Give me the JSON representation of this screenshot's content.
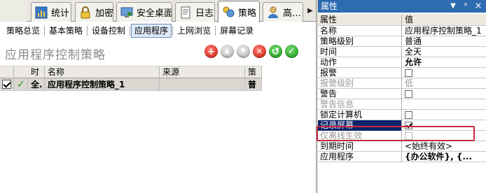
{
  "tabs": [
    {
      "label": "统计",
      "icon": "chart-icon",
      "active": false
    },
    {
      "label": "加密",
      "icon": "lock-icon",
      "active": false
    },
    {
      "label": "安全桌面",
      "icon": "monitor-icon",
      "active": false
    },
    {
      "label": "日志",
      "icon": "log-icon",
      "active": false
    },
    {
      "label": "策略",
      "icon": "policy-icon",
      "active": true
    },
    {
      "label": "高…",
      "icon": "user-icon",
      "active": false
    }
  ],
  "subnav": [
    "策略总览",
    "基本策略",
    "设备控制",
    "应用程序",
    "上网浏览",
    "屏幕记录"
  ],
  "subnav_active": "应用程序",
  "page_title": "应用程序控制策略",
  "actions": [
    {
      "name": "add-icon",
      "glyph": "+",
      "style": "red"
    },
    {
      "name": "move-up-icon",
      "glyph": "▲",
      "style": "gray"
    },
    {
      "name": "move-down-icon",
      "glyph": "▼",
      "style": "gray"
    },
    {
      "name": "delete-icon",
      "glyph": "✕",
      "style": "red"
    },
    {
      "name": "undo-icon",
      "glyph": "↺",
      "style": "green"
    },
    {
      "name": "confirm-icon",
      "glyph": "✓",
      "style": "green"
    }
  ],
  "grid": {
    "columns": [
      "",
      "时",
      "名称",
      "来源",
      "策"
    ],
    "rows": [
      {
        "checked": true,
        "enabled_mark": "✓",
        "time": "全.",
        "name": "应用程序控制策略_1",
        "source": "",
        "level": "普"
      }
    ]
  },
  "props": {
    "title": "属性",
    "pin_label": "ᵠ",
    "close_label": "×",
    "header_key": "属性",
    "header_value": "值",
    "rows": [
      {
        "key": "名称",
        "value": "应用程序控制策略_1",
        "type": "text"
      },
      {
        "key": "策略级别",
        "value": "普通",
        "type": "text"
      },
      {
        "key": "时间",
        "value": "全天",
        "type": "text"
      },
      {
        "key": "动作",
        "value": "允许",
        "type": "text",
        "bold": true
      },
      {
        "key": "报警",
        "value": "",
        "type": "checkbox",
        "checked": false
      },
      {
        "key": "报警级别",
        "value": "低",
        "type": "text",
        "disabled": true
      },
      {
        "key": "警告",
        "value": "",
        "type": "checkbox",
        "checked": false
      },
      {
        "key": "警告信息",
        "value": "",
        "type": "text",
        "disabled": true
      },
      {
        "key": "锁定计算机",
        "value": "",
        "type": "checkbox",
        "checked": false
      },
      {
        "key": "记录屏幕",
        "value": "",
        "type": "checkbox",
        "checked": true,
        "selected": true
      },
      {
        "key": "仅离线生效",
        "value": "",
        "type": "checkbox",
        "checked": false,
        "disabled": true
      },
      {
        "key": "到期时间",
        "value": "<始终有效>",
        "type": "text"
      },
      {
        "key": "应用程序",
        "value": "{办公软件}, {...",
        "type": "text",
        "bold": true
      }
    ]
  },
  "colors": {
    "panel_title_bg": "#2e6bb0",
    "selected_row_bg": "#0a246a",
    "highlight_border": "#c8283c"
  }
}
